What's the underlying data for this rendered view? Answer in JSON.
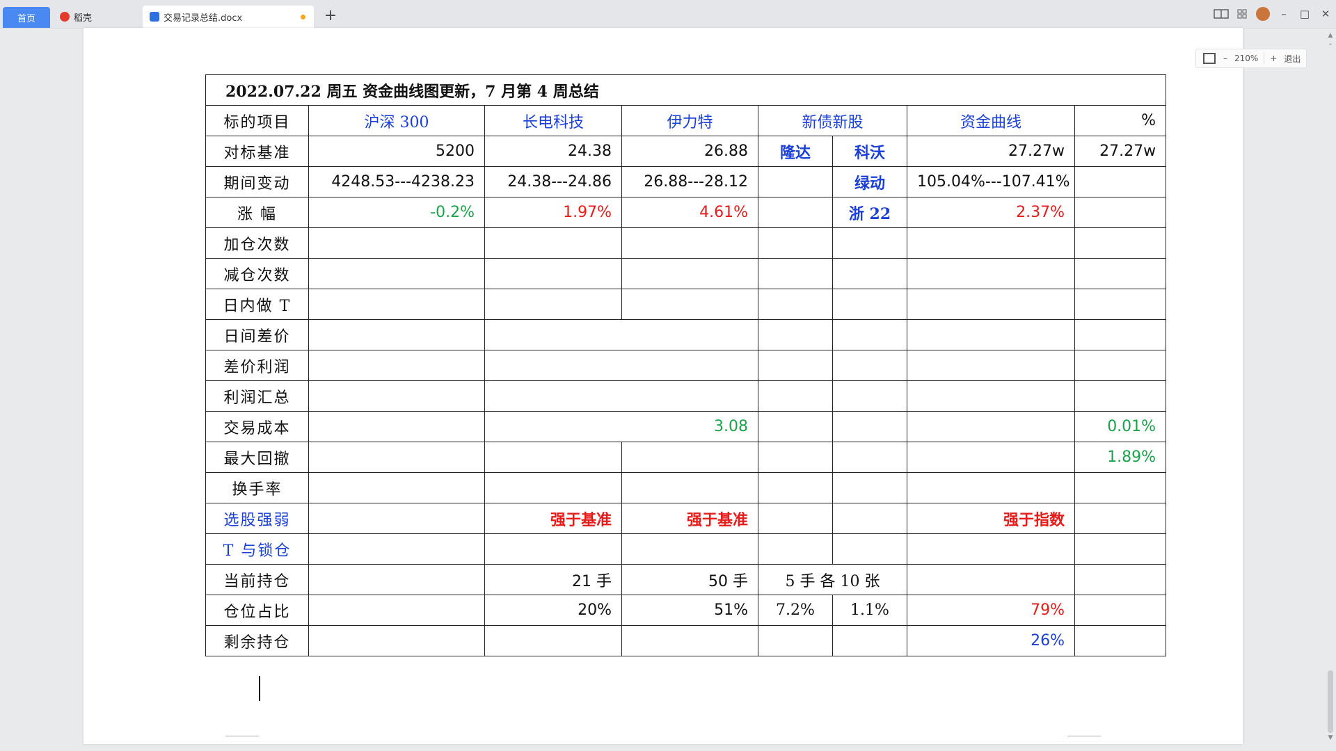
{
  "tabs": {
    "home": "首页",
    "daoke": "稻壳",
    "doc": "交易记录总结.docx",
    "new_tab": "+"
  },
  "window": {
    "minimize": "–",
    "maximize": "□",
    "close": "✕"
  },
  "zoom": {
    "minus": "–",
    "level": "210%",
    "plus": "+",
    "exit": "退出"
  },
  "table": {
    "title": "2022.07.22  周五  资金曲线图更新，7 月第 4 周总结",
    "header": {
      "label": "标的项目",
      "c1": "沪深 300",
      "c2": "长电科技",
      "c3": "伊力特",
      "c4": "新债新股",
      "c5": "资金曲线",
      "c6": "%"
    },
    "benchmark": {
      "label": "对标基准",
      "c1": "5200",
      "c2": "24.38",
      "c3": "26.88",
      "c4a": "隆达",
      "c4b": "科沃",
      "c5": "27.27w",
      "c6": "27.27w"
    },
    "change": {
      "label": "期间变动",
      "c1": "4248.53---4238.23",
      "c2": "24.38---24.86",
      "c3": "26.88---28.12",
      "c4b": "绿动",
      "c5": "105.04%---107.41%"
    },
    "pct": {
      "label": "涨  幅",
      "c1": "-0.2%",
      "c2": "1.97%",
      "c3": "4.61%",
      "c4b": "浙 22",
      "c5": "2.37%"
    },
    "rows": {
      "add": "加仓次数",
      "reduce": "减仓次数",
      "intraday": "日内做 T",
      "interday": "日间差价",
      "spread_profit": "差价利润",
      "profit_sum": "利润汇总",
      "cost": "交易成本",
      "drawdown": "最大回撤",
      "turnover": "换手率",
      "strength": "选股强弱",
      "t_lock": "T 与锁仓",
      "holding": "当前持仓",
      "ratio": "仓位占比",
      "remaining": "剩余持仓"
    },
    "cost_vals": {
      "mid": "3.08",
      "pct": "0.01%"
    },
    "drawdown_vals": {
      "pct": "1.89%"
    },
    "strength_vals": {
      "c2": "强于基准",
      "c3": "强于基准",
      "c5": "强于指数"
    },
    "holding_vals": {
      "c2": "21 手",
      "c3": "50 手",
      "c4": "5 手  各 10 张"
    },
    "ratio_vals": {
      "c2": "20%",
      "c3": "51%",
      "c4a": "7.2%",
      "c4b": "1.1%",
      "c5": "79%"
    },
    "remaining_vals": {
      "c5": "26%"
    }
  }
}
